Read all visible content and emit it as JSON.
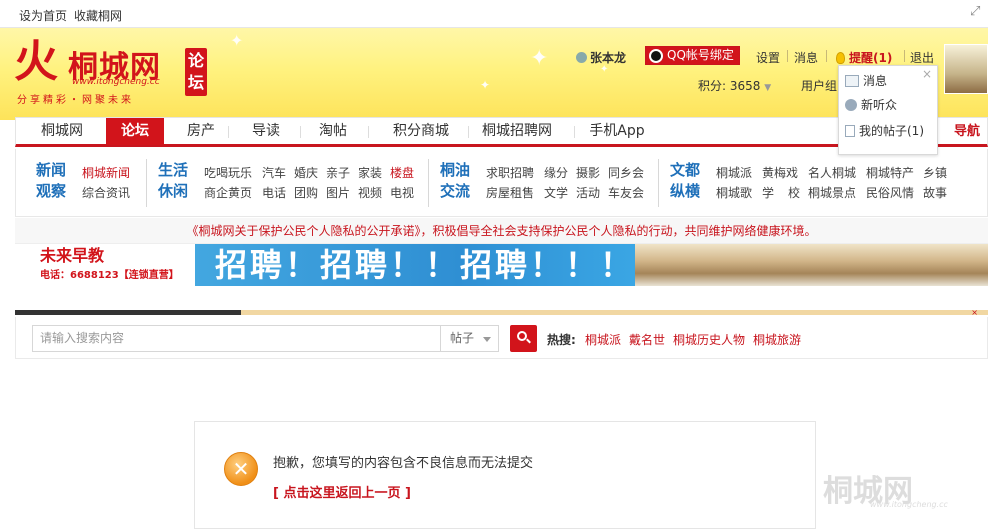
{
  "topbar": {
    "set_home": "设为首页",
    "bookmark": "收藏桐网"
  },
  "logo": {
    "mark": "火",
    "name": "桐城网",
    "url": "www.itongcheng.cc",
    "slogan": "分享精彩・网聚未来",
    "section": "论坛"
  },
  "user": {
    "name": "张本龙",
    "qq_bind": "QQ帐号绑定",
    "settings": "设置",
    "messages": "消息",
    "remind": "提醒(1)",
    "logout": "退出",
    "points": "积分: 3658",
    "user_center": "用户组"
  },
  "dropdown": {
    "close": "×",
    "items": [
      "消息",
      "新听众",
      "我的帖子(1)"
    ]
  },
  "nav": {
    "items": [
      "桐城网",
      "论坛",
      "房产",
      "导读",
      "淘帖",
      "积分商城",
      "桐城招聘网",
      "手机App"
    ],
    "guide": "导航",
    "active_index": 1
  },
  "subnav": {
    "groups": [
      {
        "cat": [
          "新闻",
          "观察"
        ],
        "row1": [
          "桐城新闻"
        ],
        "row2": [
          "综合资讯"
        ]
      },
      {
        "cat": [
          "生活",
          "休闲"
        ],
        "row1": [
          "吃喝玩乐",
          "汽车",
          "婚庆",
          "亲子",
          "家装",
          "楼盘"
        ],
        "row2": [
          "商企黄页",
          "电话",
          "团购",
          "图片",
          "视频",
          "电视"
        ]
      },
      {
        "cat": [
          "桐油",
          "交流"
        ],
        "row1": [
          "求职招聘",
          "缘分",
          "摄影",
          "同乡会"
        ],
        "row2": [
          "房屋租售",
          "文学",
          "活动",
          "车友会"
        ]
      },
      {
        "cat": [
          "文都",
          "纵横"
        ],
        "row1": [
          "桐城派",
          "黄梅戏",
          "名人桐城",
          "桐城特产",
          "乡镇"
        ],
        "row2": [
          "桐城歌",
          "学",
          "校",
          "桐城景点",
          "民俗风情",
          "故事"
        ]
      }
    ]
  },
  "notice": "《桐城网关于保护公民个人隐私的公开承诺》，积极倡导全社会支持保护公民个人隐私的行动，共同维护网络健康环境。",
  "banner": {
    "brand": "未来早教",
    "phone": "电话：6688123【连锁直营】",
    "headline": "招聘！招聘！！招聘！！！"
  },
  "search": {
    "placeholder": "请输入搜索内容",
    "type": "帖子",
    "hot_label": "热搜:",
    "hot": [
      "桐城派",
      "戴名世",
      "桐城历史人物",
      "桐城旅游"
    ]
  },
  "message": {
    "text": "抱歉，您填写的内容包含不良信息而无法提交",
    "back": "[ 点击这里返回上一页 ]"
  },
  "watermark": {
    "name": "桐城网",
    "url": "www.itongcheng.cc"
  },
  "colors": {
    "brand_red": "#d2141b",
    "link_blue": "#1f70b9",
    "header_yellow": "#fde35a"
  }
}
